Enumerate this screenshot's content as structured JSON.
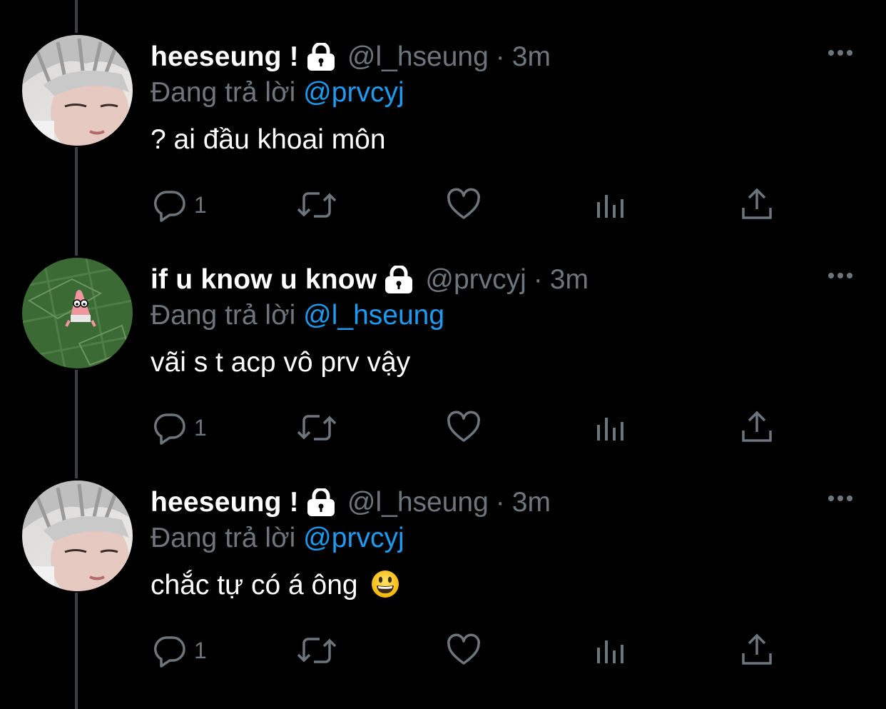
{
  "tweets": [
    {
      "display_name": "heeseung !",
      "handle": "@l_hseung",
      "separator": "·",
      "time": "3m",
      "reply_prefix": "Đang trả lời",
      "reply_to": "@prvcyj",
      "text": "? ai đầu khoai môn",
      "reply_count": "1",
      "avatar": "person-avatar"
    },
    {
      "display_name": "if u know u know",
      "handle": "@prvcyj",
      "separator": "·",
      "time": "3m",
      "reply_prefix": "Đang trả lời",
      "reply_to": "@l_hseung",
      "text": "vãi s t acp vô prv vậy",
      "reply_count": "1",
      "avatar": "patrick-field-avatar"
    },
    {
      "display_name": "heeseung !",
      "handle": "@l_hseung",
      "separator": "·",
      "time": "3m",
      "reply_prefix": "Đang trả lời",
      "reply_to": "@prvcyj",
      "text": "chắc tự có á ông",
      "emoji": "grinning-face-emoji",
      "reply_count": "1",
      "avatar": "person-avatar"
    }
  ],
  "colors": {
    "background": "#000000",
    "text_primary": "#ffffff",
    "text_secondary": "#6e767d",
    "mention": "#1d9bf0",
    "thread_line": "#3b4045"
  },
  "icons": [
    "lock-icon",
    "more-icon",
    "reply-icon",
    "retweet-icon",
    "like-icon",
    "analytics-icon",
    "share-icon"
  ]
}
